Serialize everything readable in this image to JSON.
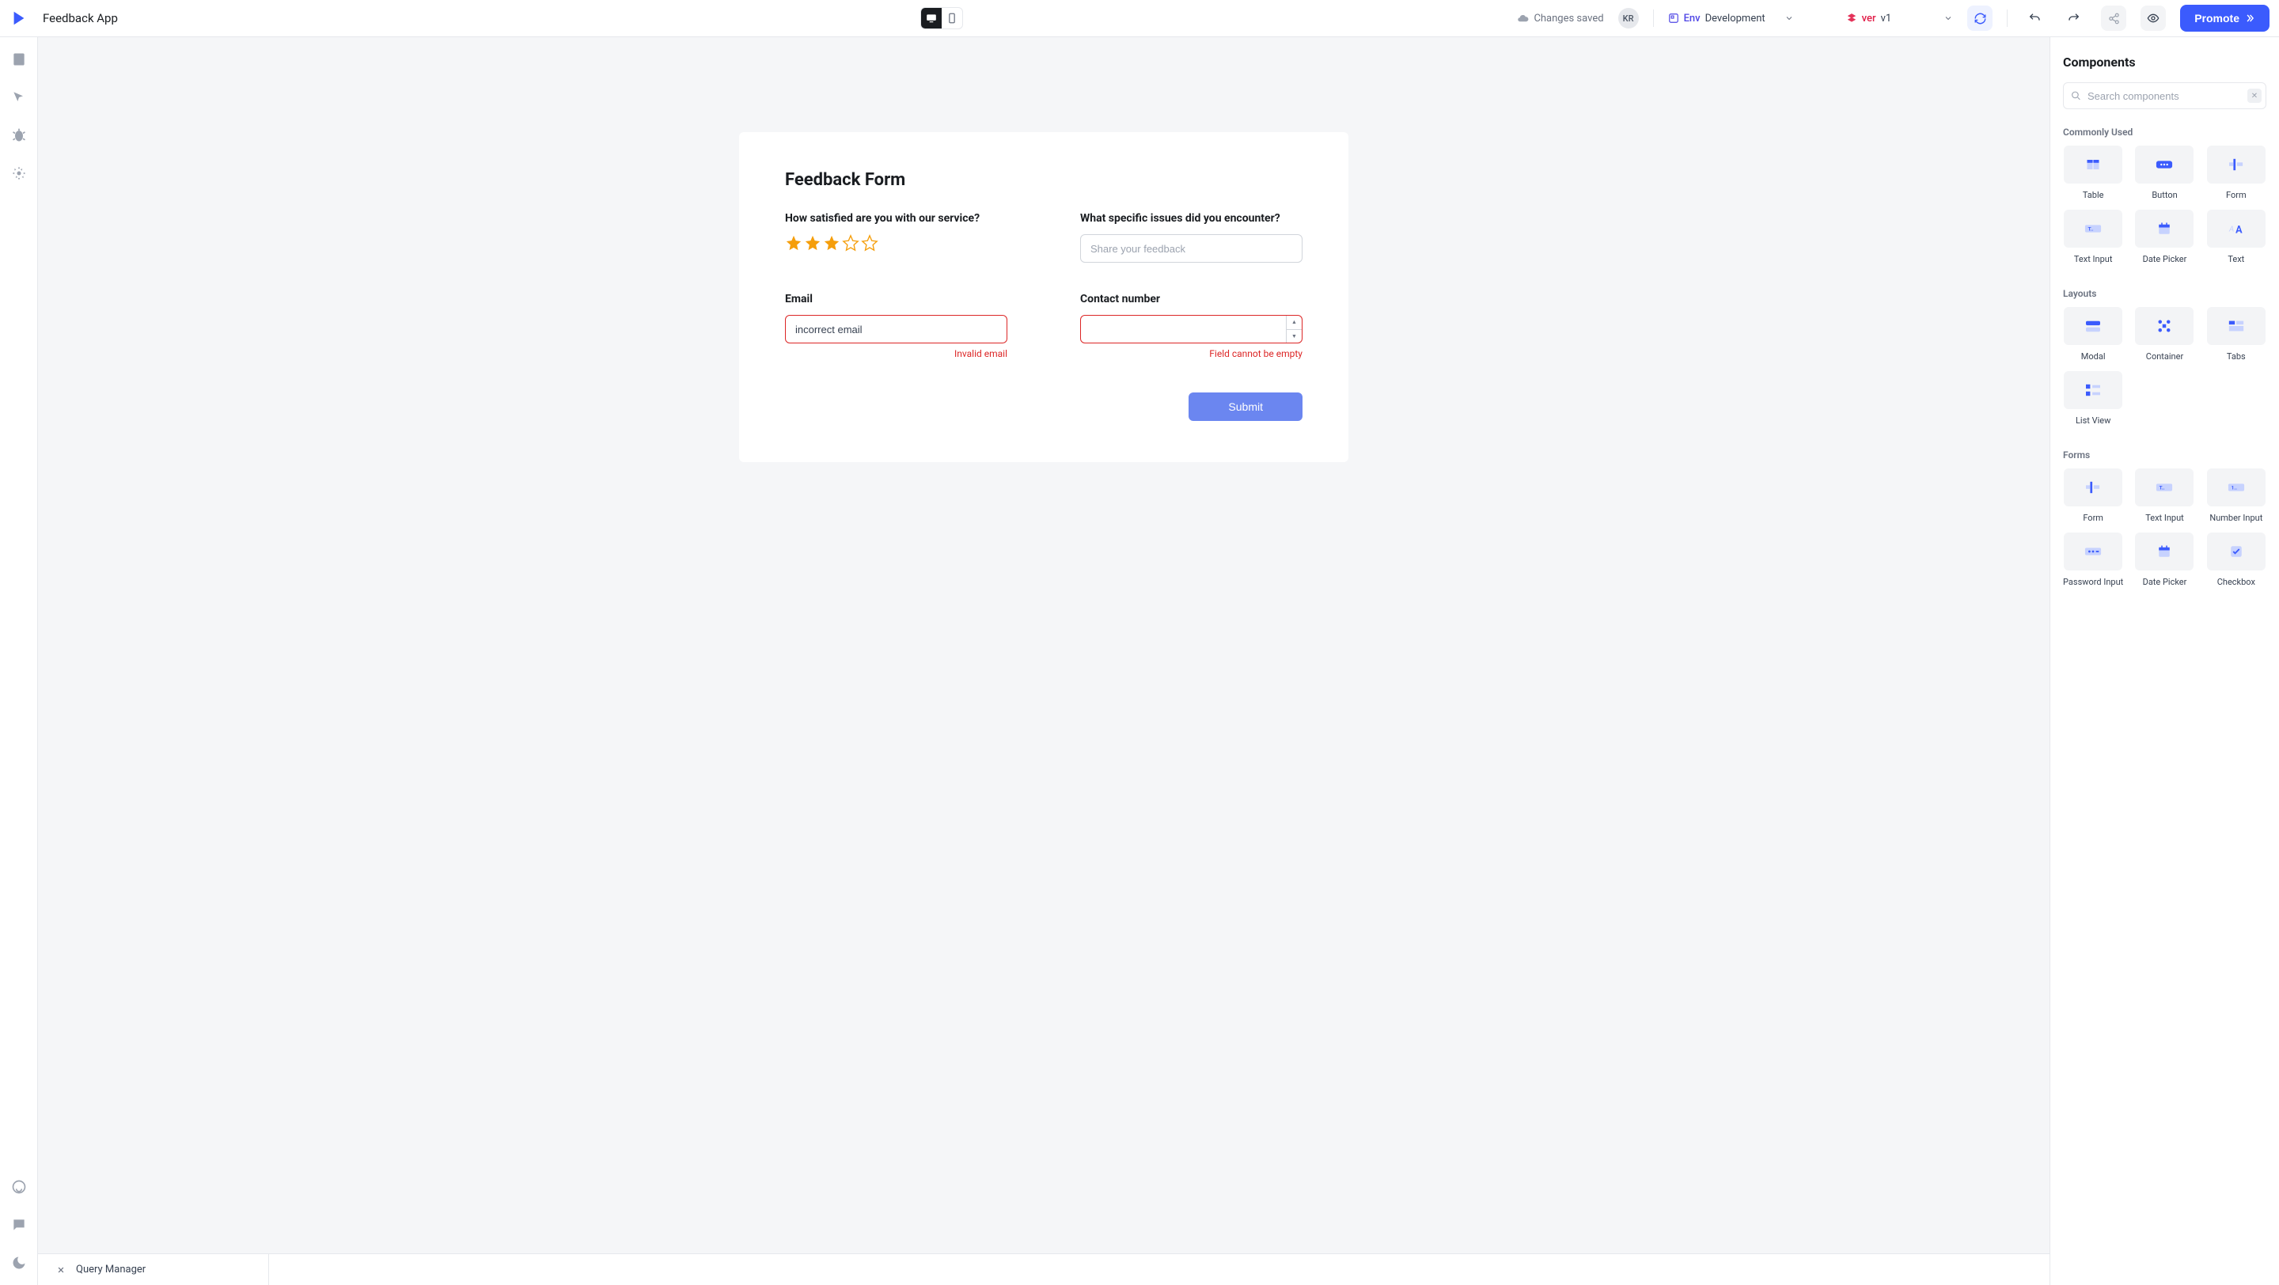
{
  "header": {
    "app_name": "Feedback App",
    "save_status": "Changes saved",
    "user_initials": "KR",
    "env_label": "Env",
    "env_value": "Development",
    "ver_label": "ver",
    "ver_value": "v1",
    "promote_label": "Promote"
  },
  "canvas": {
    "form_title": "Feedback Form",
    "fields": {
      "satisfaction": {
        "label": "How satisfied are you with our service?",
        "rating": 3,
        "max": 5
      },
      "issues": {
        "label": "What specific issues did you encounter?",
        "placeholder": "Share your feedback",
        "value": ""
      },
      "email": {
        "label": "Email",
        "value": "incorrect email",
        "error": "Invalid email"
      },
      "contact": {
        "label": "Contact number",
        "value": "",
        "error": "Field cannot be empty"
      }
    },
    "submit_label": "Submit"
  },
  "bottom": {
    "query_manager": "Query Manager"
  },
  "rightpanel": {
    "title": "Components",
    "search_placeholder": "Search components",
    "sections": [
      {
        "label": "Commonly Used",
        "items": [
          "Table",
          "Button",
          "Form",
          "Text Input",
          "Date Picker",
          "Text"
        ]
      },
      {
        "label": "Layouts",
        "items": [
          "Modal",
          "Container",
          "Tabs",
          "List View"
        ]
      },
      {
        "label": "Forms",
        "items": [
          "Form",
          "Text Input",
          "Number Input",
          "Password Input",
          "Date Picker",
          "Checkbox"
        ]
      }
    ]
  },
  "colors": {
    "accent": "#3b5bfd",
    "error": "#dc2626",
    "star": "#f59e0b"
  }
}
